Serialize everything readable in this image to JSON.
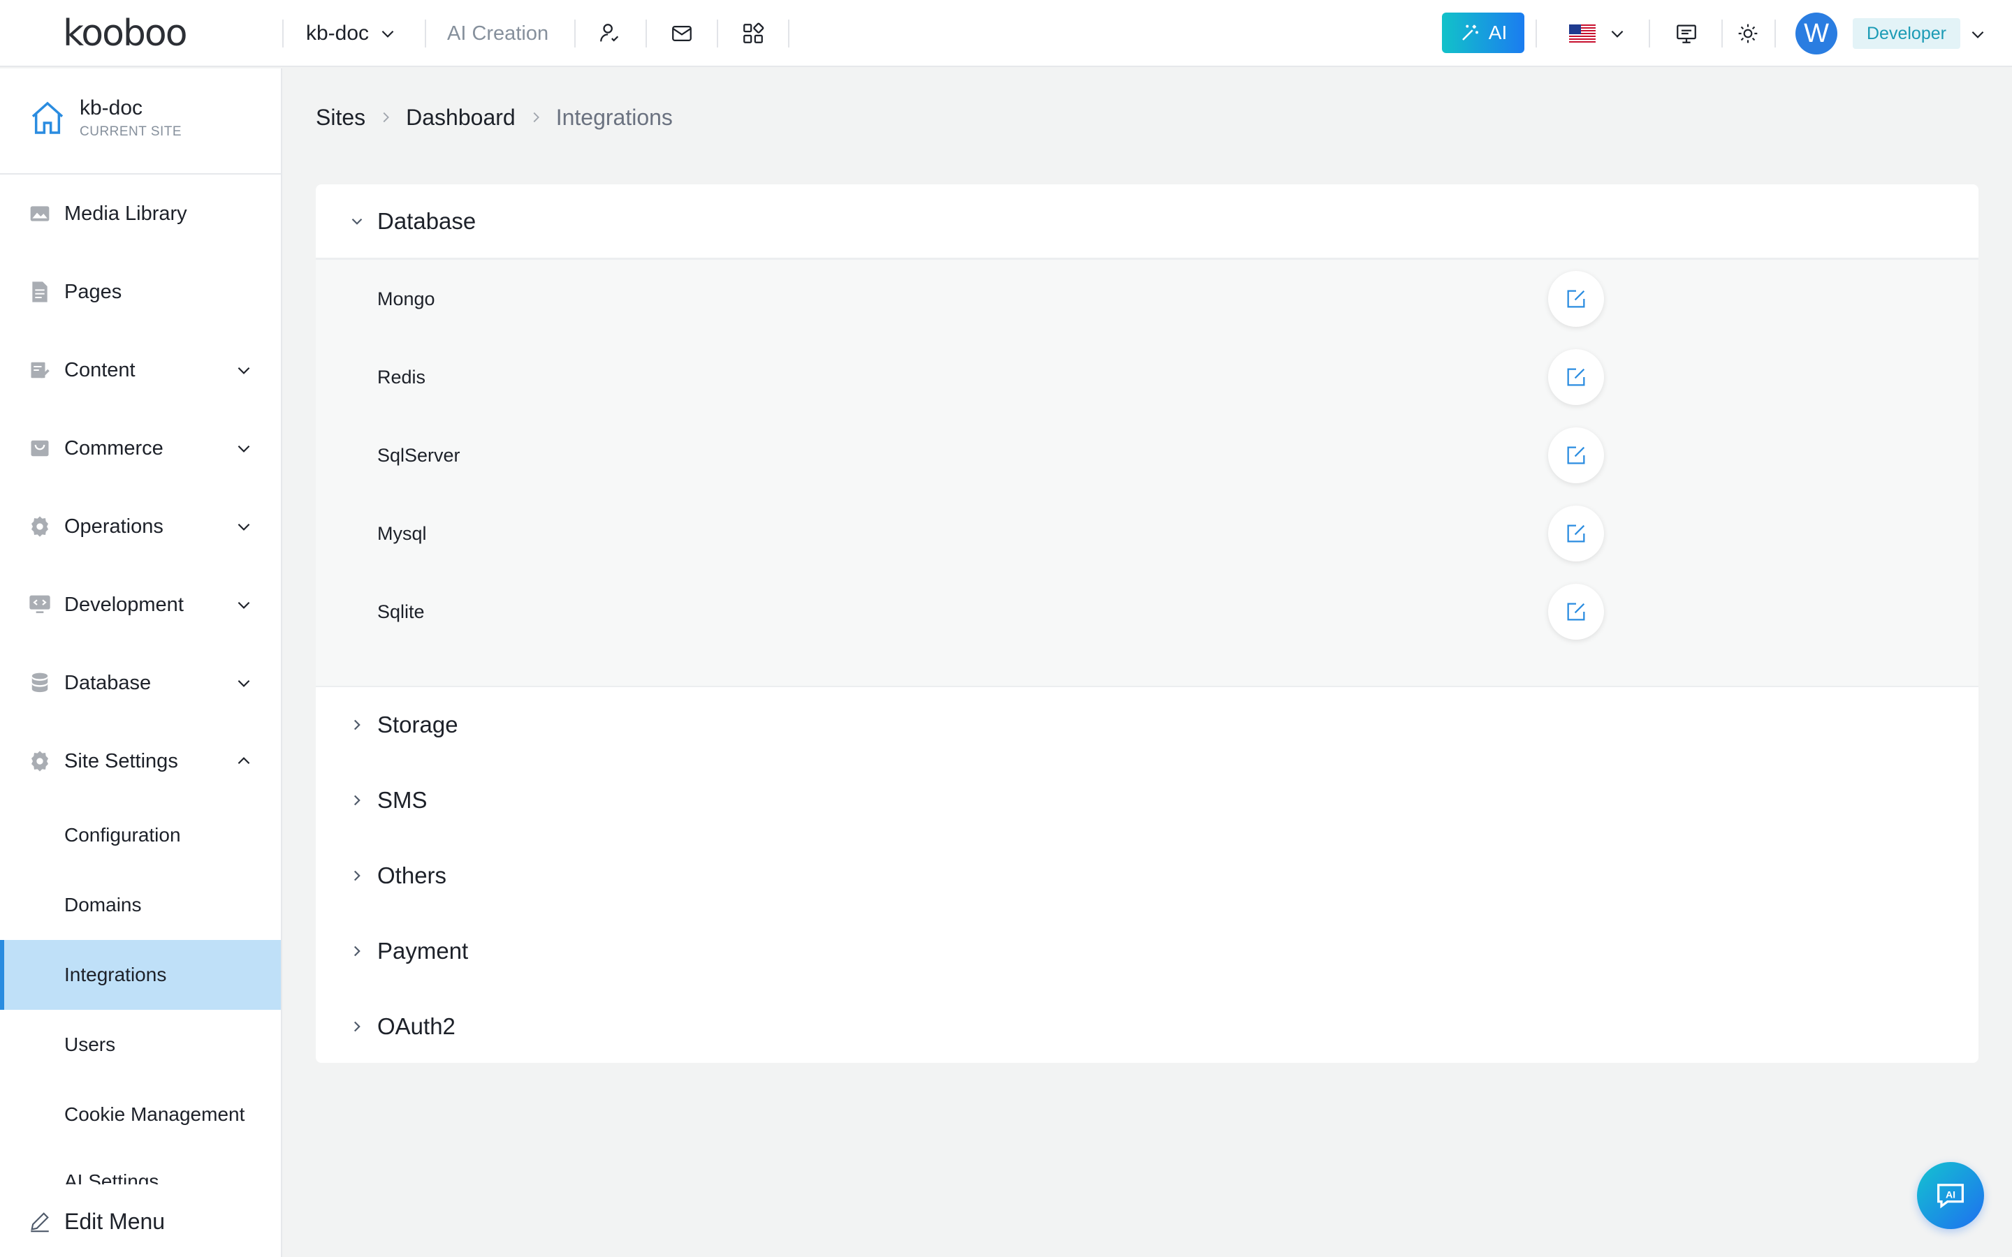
{
  "header": {
    "logo_text": "kooboo",
    "site_switch": "kb-doc",
    "ai_creation": "AI Creation",
    "ai_button": "AI",
    "avatar_letter": "W",
    "role": "Developer"
  },
  "sidebar": {
    "current_site": {
      "name": "kb-doc",
      "label": "CURRENT SITE"
    },
    "items": [
      {
        "label": "Media Library",
        "expandable": false
      },
      {
        "label": "Pages",
        "expandable": false
      },
      {
        "label": "Content",
        "expandable": true
      },
      {
        "label": "Commerce",
        "expandable": true
      },
      {
        "label": "Operations",
        "expandable": true
      },
      {
        "label": "Development",
        "expandable": true
      },
      {
        "label": "Database",
        "expandable": true
      },
      {
        "label": "Site Settings",
        "expandable": true,
        "expanded": true
      }
    ],
    "site_settings_children": [
      {
        "label": "Configuration"
      },
      {
        "label": "Domains"
      },
      {
        "label": "Integrations",
        "active": true
      },
      {
        "label": "Users"
      },
      {
        "label": "Cookie Management"
      },
      {
        "label": "AI Settings"
      }
    ],
    "edit_menu": "Edit Menu"
  },
  "breadcrumb": [
    "Sites",
    "Dashboard",
    "Integrations"
  ],
  "sections": {
    "database": {
      "title": "Database",
      "expanded": true,
      "items": [
        "Mongo",
        "Redis",
        "SqlServer",
        "Mysql",
        "Sqlite"
      ]
    },
    "collapsed": [
      "Storage",
      "SMS",
      "Others",
      "Payment",
      "OAuth2"
    ]
  },
  "colors": {
    "accent": "#2a8ce0",
    "active_bg": "#bfe0f8",
    "role_bg": "#e3f3f7",
    "role_text": "#1b9bb5",
    "ai_gradient_start": "#12c2c9",
    "ai_gradient_end": "#1b7cf0"
  },
  "icons": {
    "header": [
      "user-link-icon",
      "mail-icon",
      "apps-grid-icon",
      "magic-wand-icon",
      "us-flag-icon",
      "monitor-icon",
      "sun-icon"
    ],
    "chat_fab": "ai-chat-icon"
  }
}
